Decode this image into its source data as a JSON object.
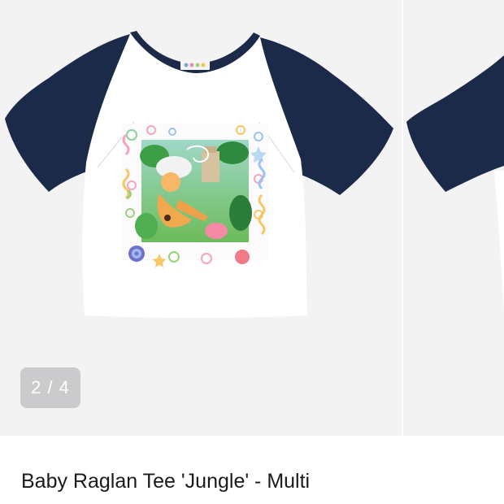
{
  "gallery": {
    "counter": "2 / 4",
    "current_index": 2,
    "total": 4,
    "background_color": "#f3f3f4"
  },
  "product": {
    "title": "Baby Raglan Tee 'Jungle' - Multi",
    "colors": {
      "body": "#ffffff",
      "sleeves": "#1c2a4a"
    }
  }
}
